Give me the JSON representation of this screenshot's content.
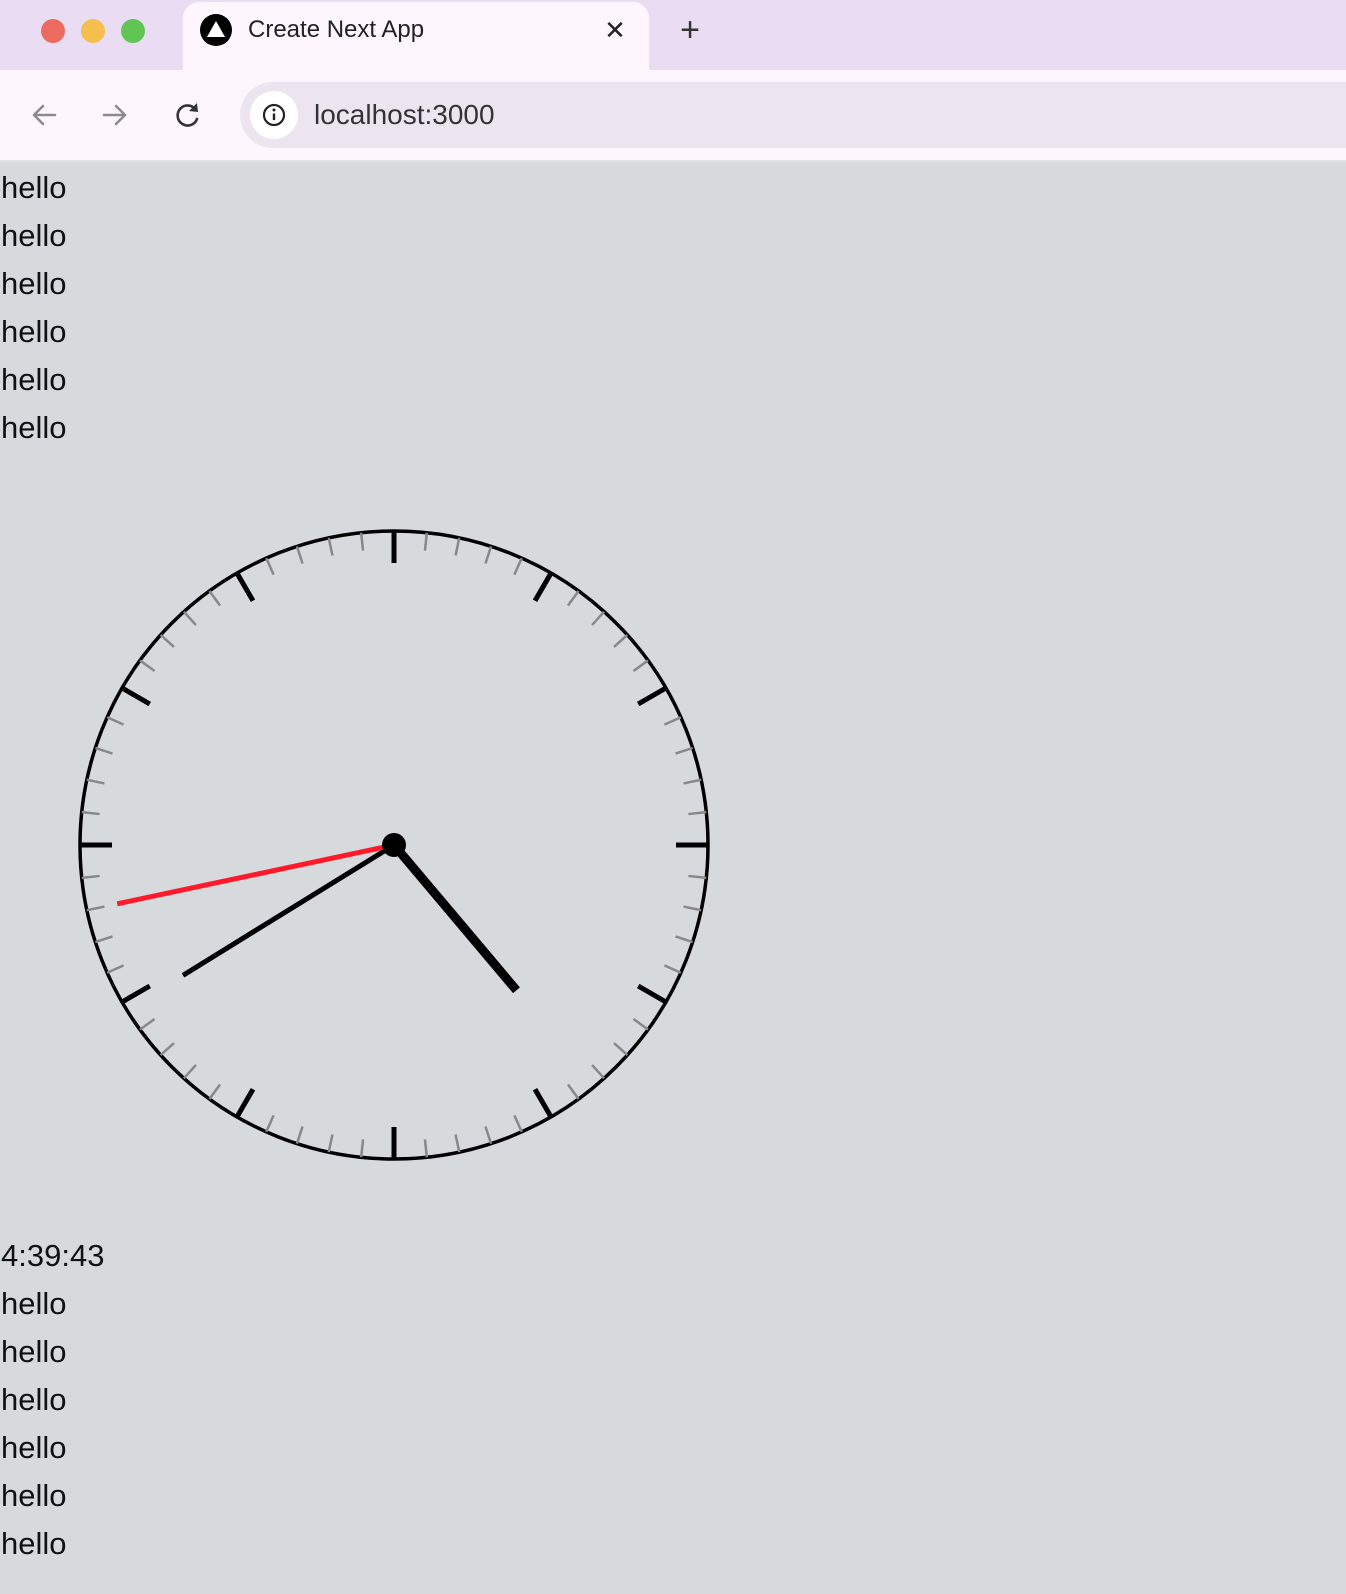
{
  "browser": {
    "tab_title": "Create Next App",
    "tab_close": "✕",
    "new_tab": "+",
    "url": "localhost:3000"
  },
  "page": {
    "top_lines": [
      "hello",
      "hello",
      "hello",
      "hello",
      "hello",
      "hello"
    ],
    "time_text": "4:39:43",
    "bottom_lines": [
      "hello",
      "hello",
      "hello",
      "hello",
      "hello",
      "hello"
    ]
  },
  "clock": {
    "hours": 4,
    "minutes": 39,
    "seconds": 43,
    "face_color": "#d7dadc",
    "hand_color": "#000000",
    "second_hand_color": "#ff1a2a",
    "minor_tick_color": "#888888"
  }
}
